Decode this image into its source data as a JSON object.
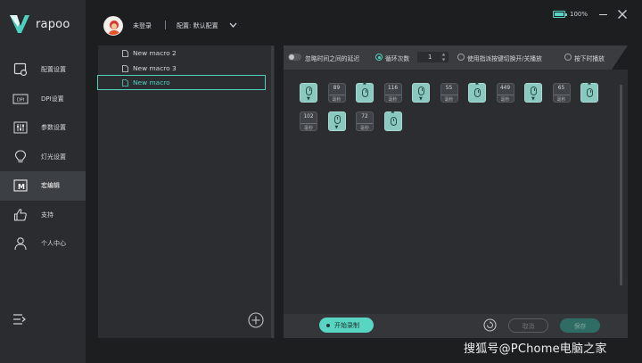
{
  "app": {
    "brand": "rapoo"
  },
  "header": {
    "user_label": "未登录",
    "config_label": "配置: 默认配置",
    "battery": "100%"
  },
  "sidebar": {
    "items": [
      {
        "label": "配置设置",
        "icon": "config-icon"
      },
      {
        "label": "DPI设置",
        "icon": "dpi-icon"
      },
      {
        "label": "参数设置",
        "icon": "sliders-icon"
      },
      {
        "label": "灯光设置",
        "icon": "lightbulb-icon"
      },
      {
        "label": "宏编辑",
        "icon": "macro-icon",
        "active": true
      },
      {
        "label": "支持",
        "icon": "thumbs-up-icon"
      },
      {
        "label": "个人中心",
        "icon": "user-icon"
      }
    ]
  },
  "macros": {
    "items": [
      {
        "name": "New macro 2"
      },
      {
        "name": "New macro 3"
      },
      {
        "name": "New macro",
        "selected": true
      }
    ]
  },
  "editor": {
    "ignore_delay_label": "忽略时间之间的延迟",
    "loop_count_label": "循环次数",
    "loop_count_value": "1",
    "toggle_play_label": "使用指派按键切换开/关播放",
    "hold_play_label": "按下时播放",
    "steps_row1": [
      {
        "kind": "key",
        "dir": "down"
      },
      {
        "kind": "delay",
        "value": "89",
        "unit": "毫秒"
      },
      {
        "kind": "key",
        "dir": "up"
      },
      {
        "kind": "delay",
        "value": "116",
        "unit": "毫秒"
      },
      {
        "kind": "key",
        "dir": "down"
      },
      {
        "kind": "delay",
        "value": "55",
        "unit": "毫秒"
      },
      {
        "kind": "key",
        "dir": "up"
      },
      {
        "kind": "delay",
        "value": "449",
        "unit": "毫秒"
      },
      {
        "kind": "key",
        "dir": "down"
      },
      {
        "kind": "delay",
        "value": "65",
        "unit": "毫秒"
      },
      {
        "kind": "key",
        "dir": "up"
      }
    ],
    "steps_row2": [
      {
        "kind": "delay",
        "value": "102",
        "unit": "毫秒"
      },
      {
        "kind": "key",
        "dir": "down"
      },
      {
        "kind": "delay",
        "value": "72",
        "unit": "毫秒"
      },
      {
        "kind": "key",
        "dir": "up"
      }
    ]
  },
  "actions": {
    "record_label": "开始录制",
    "cancel_label": "取消",
    "save_label": "保存"
  },
  "watermark": "搜狐号@PChome电脑之家",
  "colors": {
    "accent": "#58d5c3",
    "panel": "#2b2d30",
    "sidebar": "#2a2c2f"
  }
}
